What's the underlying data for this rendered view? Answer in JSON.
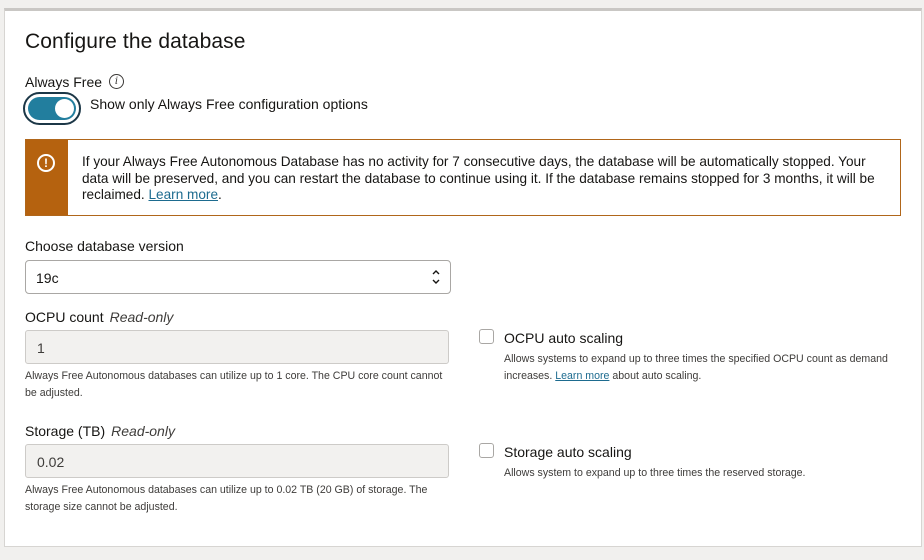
{
  "section": {
    "title": "Configure the database"
  },
  "always_free": {
    "label": "Always Free",
    "info_icon": "i",
    "toggle_on": true,
    "toggle_label": "Show only Always Free configuration options"
  },
  "alert": {
    "icon": "!",
    "text": "If your Always Free Autonomous Database has no activity for 7 consecutive days, the database will be automatically stopped. Your data will be preserved, and you can restart the database to continue using it. If the database remains stopped for 3 months, it will be reclaimed.",
    "link": "Learn more",
    "suffix": "."
  },
  "version": {
    "label": "Choose database version",
    "value": "19c"
  },
  "ocpu": {
    "label": "OCPU count",
    "readonly_tag": "Read-only",
    "value": "1",
    "help_text": "Always Free Autonomous databases can utilize up to 1 core. The CPU core count cannot be adjusted."
  },
  "ocpu_scaling": {
    "label": "OCPU auto scaling",
    "checked": false,
    "help_prefix": "Allows systems to expand up to three times the specified OCPU count as demand increases.",
    "help_link": "Learn more",
    "help_suffix": "about auto scaling."
  },
  "storage": {
    "label": "Storage (TB)",
    "readonly_tag": "Read-only",
    "value": "0.02",
    "help_text": "Always Free Autonomous databases can utilize up to 0.02 TB (20 GB) of storage. The storage size cannot be adjusted."
  },
  "storage_scaling": {
    "label": "Storage auto scaling",
    "checked": false,
    "help_text": "Allows system to expand up to three times the reserved storage."
  },
  "colors": {
    "accent": "#227e9e",
    "warning": "#b5620f",
    "link": "#1d6b8f"
  }
}
